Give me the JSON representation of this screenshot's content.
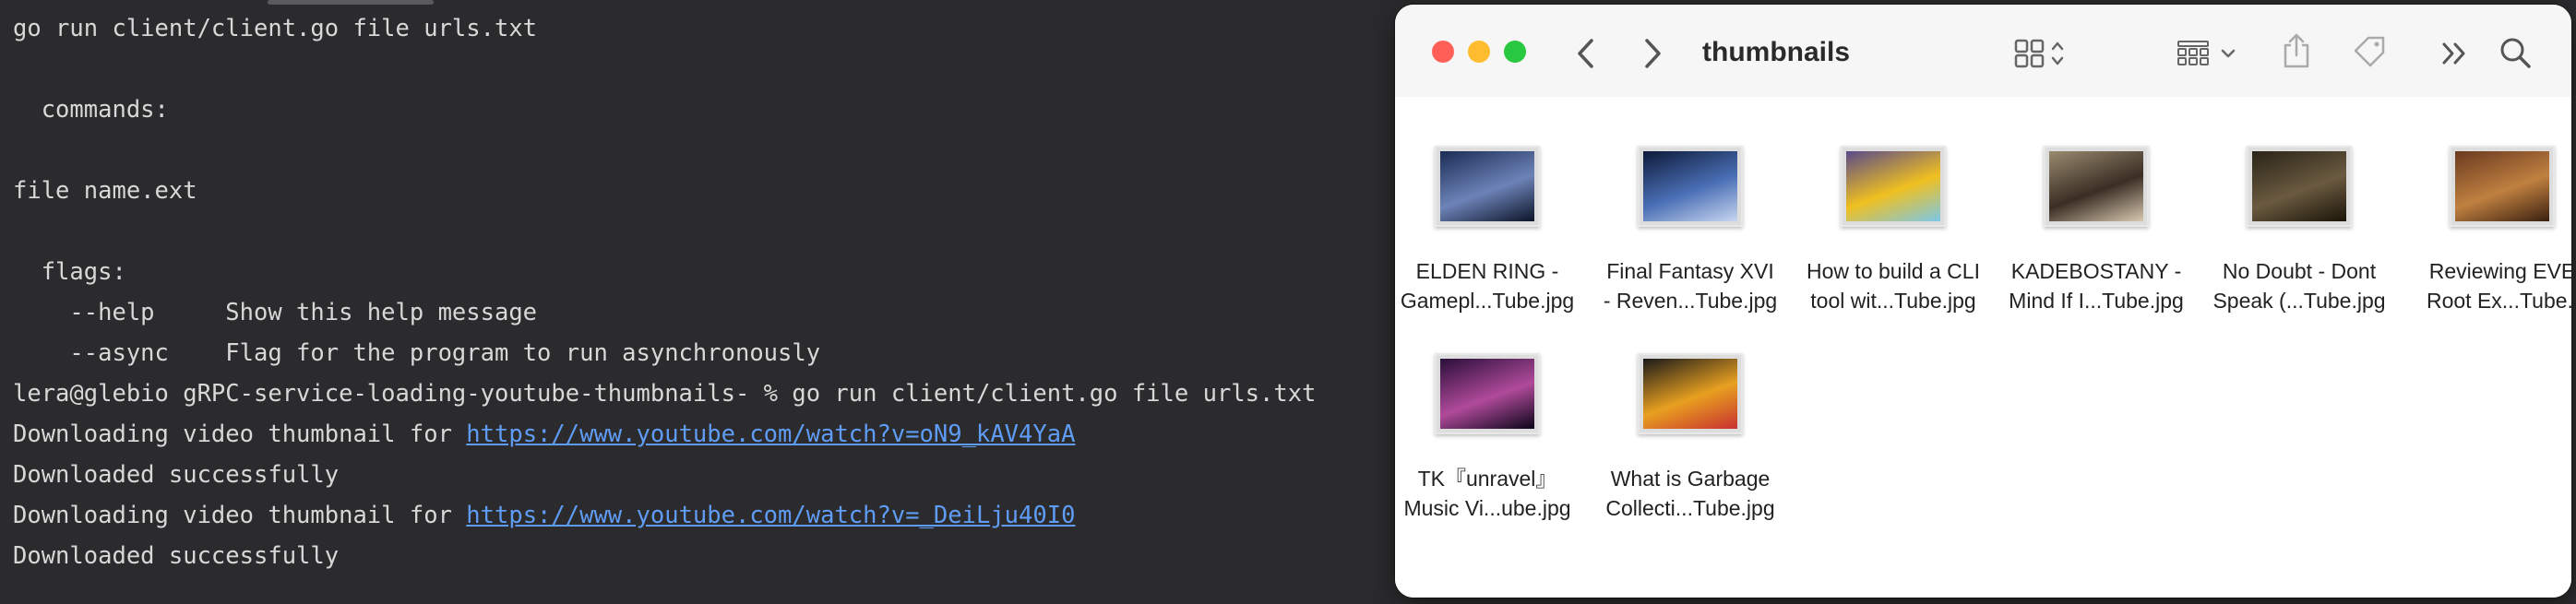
{
  "terminal": {
    "lines": [
      "go run client/client.go file urls.txt",
      "",
      "  commands:",
      "",
      "file name.ext",
      "",
      "  flags:",
      "    --help     Show this help message",
      "    --async    Flag for the program to run asynchronously",
      "lera@glebio gRPC-service-loading-youtube-thumbnails- % go run client/client.go file urls.txt"
    ],
    "download_prefix": "Downloading video thumbnail for ",
    "downloads": [
      {
        "url": "https://www.youtube.com/watch?v=oN9_kAV4YaA",
        "status": "Downloaded successfully"
      },
      {
        "url": "https://www.youtube.com/watch?v=_DeiLju40I0",
        "status": "Downloaded successfully"
      }
    ]
  },
  "finder": {
    "title": "thumbnails",
    "toolbar_icons": [
      "back-icon",
      "forward-icon",
      "icon-view-icon",
      "group-icon",
      "share-icon",
      "tag-icon",
      "more-icon",
      "search-icon"
    ],
    "files": [
      {
        "line1": "ELDEN RING -",
        "line2": "Gamepl...Tube.jpg",
        "thumb": [
          "#1b2d55",
          "#6d83b8",
          "#0c1428"
        ]
      },
      {
        "line1": "Final Fantasy XVI",
        "line2": "- Reven...Tube.jpg",
        "thumb": [
          "#0d1a3a",
          "#4a6fb5",
          "#c8d6f0"
        ]
      },
      {
        "line1": "How to build a CLI",
        "line2": "tool wit...Tube.jpg",
        "thumb": [
          "#5a4a8a",
          "#f0c020",
          "#7cc7e8"
        ]
      },
      {
        "line1": "KADEBOSTANY -",
        "line2": "Mind If I...Tube.jpg",
        "thumb": [
          "#9a8a70",
          "#3a2e24",
          "#d8c8b0"
        ]
      },
      {
        "line1": "No Doubt - Dont",
        "line2": "Speak (...Tube.jpg",
        "thumb": [
          "#2a2418",
          "#6a5a40",
          "#1a1408"
        ]
      },
      {
        "line1": "Reviewing EVE",
        "line2": "Root Ex...Tube.j",
        "thumb": [
          "#6a3a20",
          "#c08040",
          "#3a2010"
        ]
      },
      {
        "line1": "TK『unravel』",
        "line2": "Music Vi...ube.jpg",
        "thumb": [
          "#2a0f3a",
          "#b04a9a",
          "#0a0518"
        ]
      },
      {
        "line1": "What is Garbage",
        "line2": "Collecti...Tube.jpg",
        "thumb": [
          "#1a1a1a",
          "#e8a020",
          "#c83030"
        ]
      }
    ]
  },
  "colors": {
    "terminal_bg": "#2b2b2d",
    "terminal_text": "#d8d8d8",
    "link": "#5f9cf5",
    "close": "#ff5f57",
    "minimize": "#febc2e",
    "maximize": "#28c840"
  }
}
